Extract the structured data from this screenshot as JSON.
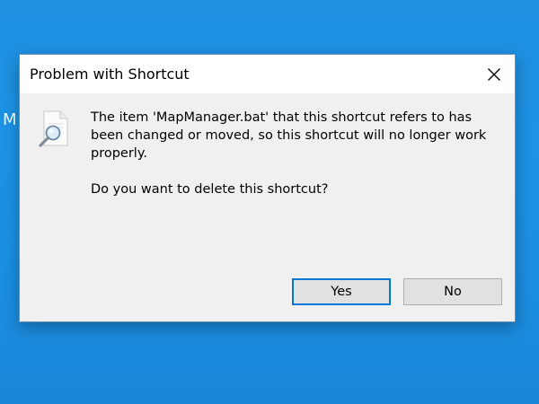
{
  "desktop": {
    "edge_fragment_text": "M",
    "background_color": "#1d8fe2"
  },
  "dialog": {
    "title": "Problem with Shortcut",
    "close_icon": "close-icon",
    "icon": "file-search-icon",
    "message_line": "The item 'MapManager.bat' that this shortcut refers to has been changed or moved, so this shortcut will no longer work properly.",
    "question": "Do you want to delete this shortcut?",
    "buttons": {
      "yes_label": "Yes",
      "no_label": "No"
    },
    "accent_color": "#0078d7"
  }
}
